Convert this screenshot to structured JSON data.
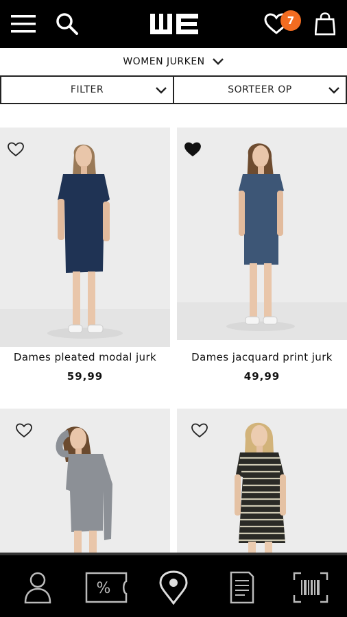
{
  "header": {
    "logo_text": "WE",
    "cart_count": "7",
    "icons": [
      "menu-icon",
      "search-icon",
      "heart-icon",
      "shopping-bag-icon"
    ]
  },
  "category": {
    "label": "WOMEN JURKEN"
  },
  "filters": {
    "filter_label": "FILTER",
    "sort_label": "SORTEER OP"
  },
  "products": [
    {
      "name": "Dames pleated modal jurk",
      "price": "59,99",
      "favorited": false,
      "dress_color": "#1f3354"
    },
    {
      "name": "Dames jacquard print jurk",
      "price": "49,99",
      "favorited": true,
      "dress_color": "#3d5676"
    },
    {
      "name": "",
      "price": "",
      "favorited": false,
      "dress_color": "#8c9096"
    },
    {
      "name": "",
      "price": "",
      "favorited": false,
      "dress_color": "#2a2a26"
    }
  ],
  "bottom_nav": [
    {
      "icon": "account-icon"
    },
    {
      "icon": "discount-coupon-icon"
    },
    {
      "icon": "location-pin-icon"
    },
    {
      "icon": "receipt-icon"
    },
    {
      "icon": "barcode-scan-icon"
    }
  ],
  "colors": {
    "accent": "#f26c21",
    "bar": "#000000",
    "tile": "#ececec"
  }
}
